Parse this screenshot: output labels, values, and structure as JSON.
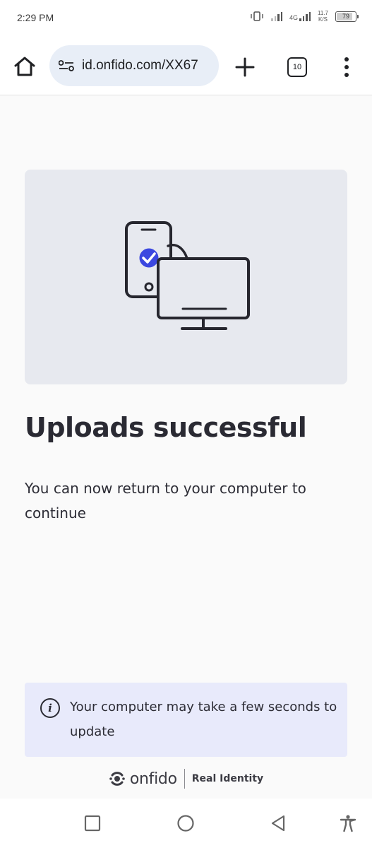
{
  "status_bar": {
    "time": "2:29 PM",
    "network_type": "4G",
    "net_speed_value": "11.7",
    "net_speed_unit": "K/S",
    "battery_level": "79",
    "battery_fraction": 0.79
  },
  "browser": {
    "url": "id.onfido.com/XX67",
    "tab_count": "10",
    "icons": {
      "home": "home-icon",
      "site_settings": "site-settings-icon",
      "new_tab": "plus-icon",
      "tab_switcher": "tab-switcher-icon",
      "menu": "more-vert-icon"
    }
  },
  "main": {
    "illustration_icon": "phone-to-computer-icon",
    "title": "Uploads successful",
    "subtitle": "You can now return to your computer to continue",
    "info": {
      "icon": "info-icon",
      "text": "Your computer may take a few seconds to update"
    }
  },
  "footer": {
    "brand_name": "onfido",
    "tagline": "Real Identity"
  },
  "nav": {
    "icons": [
      "recents-square-icon",
      "home-circle-icon",
      "back-triangle-icon",
      "accessibility-icon"
    ]
  },
  "colors": {
    "accent": "#3b47e0",
    "illustration_bg": "#e7e9ef",
    "info_bg": "#e8eafb",
    "url_bar_bg": "#e8eef7",
    "text": "#2a2a33"
  }
}
